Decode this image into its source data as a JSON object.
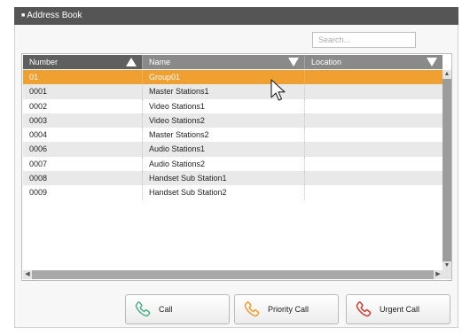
{
  "window": {
    "title": "Address Book"
  },
  "search": {
    "placeholder": "Search..."
  },
  "table": {
    "columns": [
      "Number",
      "Name",
      "Location"
    ],
    "rows": [
      {
        "number": "01",
        "name": "Group01",
        "location": "",
        "selected": true
      },
      {
        "number": "0001",
        "name": "Master Stations1",
        "location": ""
      },
      {
        "number": "0002",
        "name": "Video Stations1",
        "location": ""
      },
      {
        "number": "0003",
        "name": "Video Stations2",
        "location": ""
      },
      {
        "number": "0004",
        "name": "Master Stations2",
        "location": ""
      },
      {
        "number": "0006",
        "name": "Audio Stations1",
        "location": ""
      },
      {
        "number": "0007",
        "name": "Audio Stations2",
        "location": ""
      },
      {
        "number": "0008",
        "name": "Handset Sub Station1",
        "location": ""
      },
      {
        "number": "0009",
        "name": "Handset Sub Station2",
        "location": ""
      }
    ]
  },
  "buttons": {
    "call": "Call",
    "priority_call": "Priority Call",
    "urgent_call": "Urgent Call"
  },
  "colors": {
    "selected_row": "#f0a030",
    "call_icon": "#4caf87",
    "priority_icon": "#f09a2a",
    "urgent_icon": "#c8392b"
  },
  "icons": {
    "call": "phone-icon",
    "priority_call": "phone-icon",
    "urgent_call": "phone-icon",
    "number_sort": "sort-ascending-icon",
    "name_sort": "sort-descending-icon",
    "location_sort": "sort-descending-icon",
    "cursor": "mouse-pointer-icon"
  }
}
